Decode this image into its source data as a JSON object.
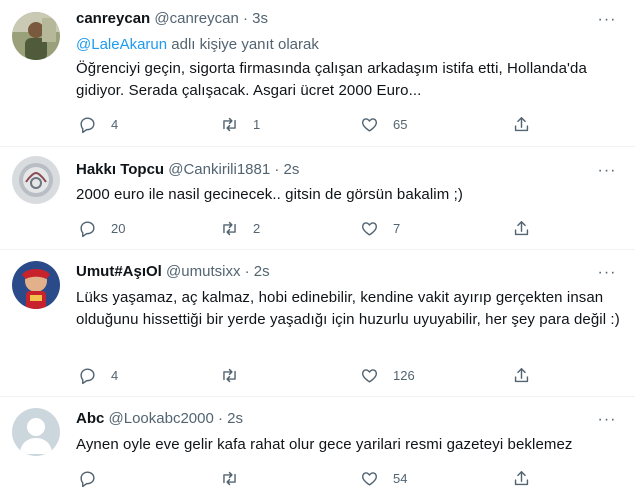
{
  "tweets": [
    {
      "name": "canreycan",
      "handle": "@canreycan",
      "time": "3s",
      "reply_mention": "@LaleAkarun",
      "reply_suffix": " adlı kişiye yanıt olarak",
      "text": "Öğrenciyi geçin, sigorta firmasında çalışan arkadaşım istifa etti, Hollanda'da gidiyor. Serada çalışacak. Asgari ücret 2000 Euro...",
      "replies": "4",
      "retweets": "1",
      "likes": "65",
      "more": "···"
    },
    {
      "name": "Hakkı Topcu",
      "handle": "@Cankirili1881",
      "time": "2s",
      "text": "2000 euro ile nasil gecinecek.. gitsin de görsün bakalim ;)",
      "replies": "20",
      "retweets": "2",
      "likes": "7",
      "more": "···"
    },
    {
      "name": "Umut#AşıOl",
      "handle": "@umutsixx",
      "time": "2s",
      "text": "Lüks yaşamaz, aç kalmaz, hobi edinebilir, kendine vakit ayırıp gerçekten insan olduğunu hissettiği bir yerde yaşadığı için huzurlu uyuyabilir, her şey para değil :)",
      "replies": "4",
      "retweets": "",
      "likes": "126",
      "more": "···"
    },
    {
      "name": "Abc",
      "handle": "@Lookabc2000",
      "time": "2s",
      "text": "Aynen oyle eve gelir kafa rahat olur gece yarilari resmi gazeteyi beklemez",
      "replies": "",
      "retweets": "",
      "likes": "54",
      "more": "···"
    }
  ],
  "separator": "·",
  "colors": {
    "link": "#1d9bf0",
    "secondary": "#536471",
    "divider": "#eff3f4"
  }
}
